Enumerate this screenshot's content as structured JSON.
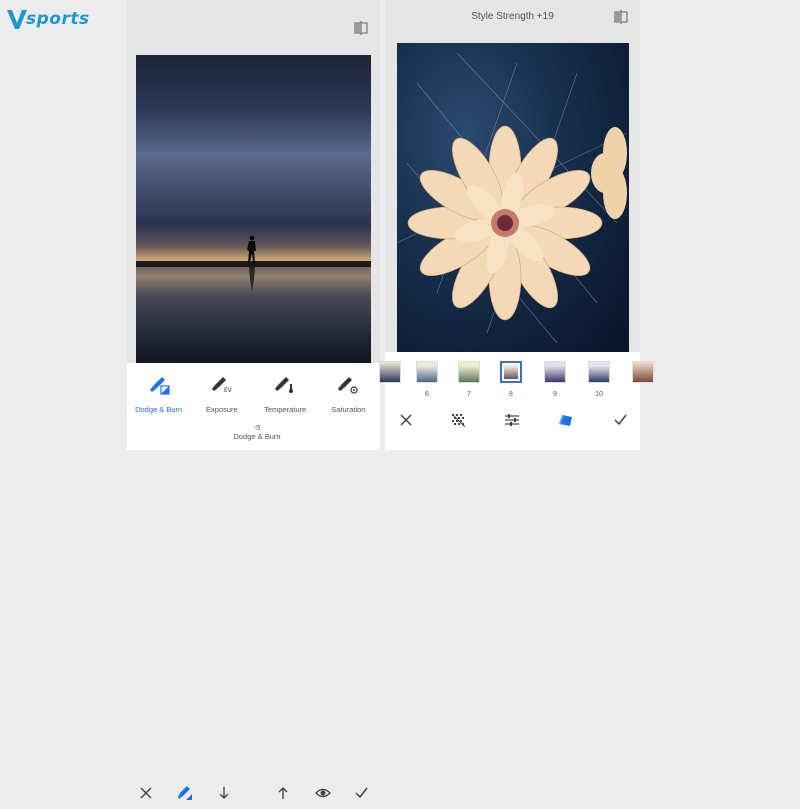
{
  "logo": {
    "text": "sports",
    "color": "#2196d3"
  },
  "left_screen": {
    "tools": [
      {
        "label": "Dodge & Burn",
        "icon": "dodge-burn-brush-icon",
        "active": true
      },
      {
        "label": "Exposure",
        "icon": "exposure-brush-icon",
        "active": false
      },
      {
        "label": "Temperature",
        "icon": "temperature-brush-icon",
        "active": false
      },
      {
        "label": "Saturation",
        "icon": "saturation-brush-icon",
        "active": false
      }
    ],
    "value_number": "-5",
    "value_label": "Dodge & Burn",
    "accent": "#1e73e0"
  },
  "right_screen": {
    "title": "Style Strength +19",
    "filters": [
      {
        "label": "6"
      },
      {
        "label": "7"
      },
      {
        "label": "8",
        "selected": true
      },
      {
        "label": "9"
      },
      {
        "label": "10"
      }
    ]
  }
}
